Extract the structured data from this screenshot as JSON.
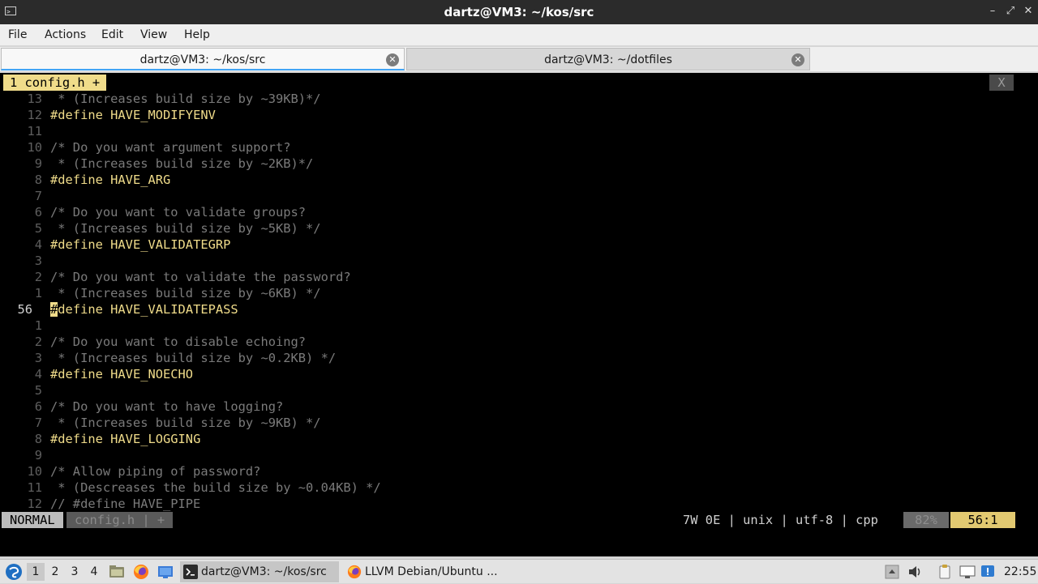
{
  "window": {
    "title": "dartz@VM3: ~/kos/src",
    "app_icon_glyph": ">_",
    "minimize_glyph": "–",
    "maximize_glyph": "⤢",
    "close_glyph": "✕"
  },
  "menu": [
    "File",
    "Actions",
    "Edit",
    "View",
    "Help"
  ],
  "tabs": [
    {
      "label": "dartz@VM3: ~/kos/src",
      "close_glyph": "✕"
    },
    {
      "label": "dartz@VM3: ~/dotfiles",
      "close_glyph": "✕"
    }
  ],
  "vim": {
    "buffer_tab": "1 config.h +",
    "close_button": "X",
    "lines": [
      {
        "num": "13",
        "text": " * (Increases build size by ~39KB)*/"
      },
      {
        "num": "12",
        "text": "#define HAVE_MODIFYENV"
      },
      {
        "num": "11",
        "text": ""
      },
      {
        "num": "10",
        "text": "/* Do you want argument support?"
      },
      {
        "num": "9",
        "text": " * (Increases build size by ~2KB)*/"
      },
      {
        "num": "8",
        "text": "#define HAVE_ARG"
      },
      {
        "num": "7",
        "text": ""
      },
      {
        "num": "6",
        "text": "/* Do you want to validate groups?"
      },
      {
        "num": "5",
        "text": " * (Increases build size by ~5KB) */"
      },
      {
        "num": "4",
        "text": "#define HAVE_VALIDATEGRP"
      },
      {
        "num": "3",
        "text": ""
      },
      {
        "num": "2",
        "text": "/* Do you want to validate the password?"
      },
      {
        "num": "1",
        "text": " * (Increases build size by ~6KB) */"
      },
      {
        "num": "56",
        "text": "#define HAVE_VALIDATEPASS"
      },
      {
        "num": "1",
        "text": ""
      },
      {
        "num": "2",
        "text": "/* Do you want to disable echoing?"
      },
      {
        "num": "3",
        "text": " * (Increases build size by ~0.2KB) */"
      },
      {
        "num": "4",
        "text": "#define HAVE_NOECHO"
      },
      {
        "num": "5",
        "text": ""
      },
      {
        "num": "6",
        "text": "/* Do you want to have logging?"
      },
      {
        "num": "7",
        "text": " * (Increases build size by ~9KB) */"
      },
      {
        "num": "8",
        "text": "#define HAVE_LOGGING"
      },
      {
        "num": "9",
        "text": ""
      },
      {
        "num": "10",
        "text": "/* Allow piping of password?"
      },
      {
        "num": "11",
        "text": " * (Descreases the build size by ~0.04KB) */"
      },
      {
        "num": "12",
        "text": "// #define HAVE_PIPE"
      }
    ],
    "status": {
      "mode": "NORMAL",
      "file": "config.h | +",
      "info": "7W 0E | unix | utf-8 | cpp",
      "percent": "82%",
      "position": "56:1"
    }
  },
  "taskbar": {
    "workspaces": [
      "1",
      "2",
      "3",
      "4"
    ],
    "tasks": [
      "dartz@VM3: ~/kos/src",
      "LLVM Debian/Ubuntu ..."
    ],
    "clock": "22:55"
  },
  "colors": {
    "accent_yellow": "#f0dc8a",
    "terminal_bg": "#000000",
    "tab_underline": "#43a5f5"
  }
}
